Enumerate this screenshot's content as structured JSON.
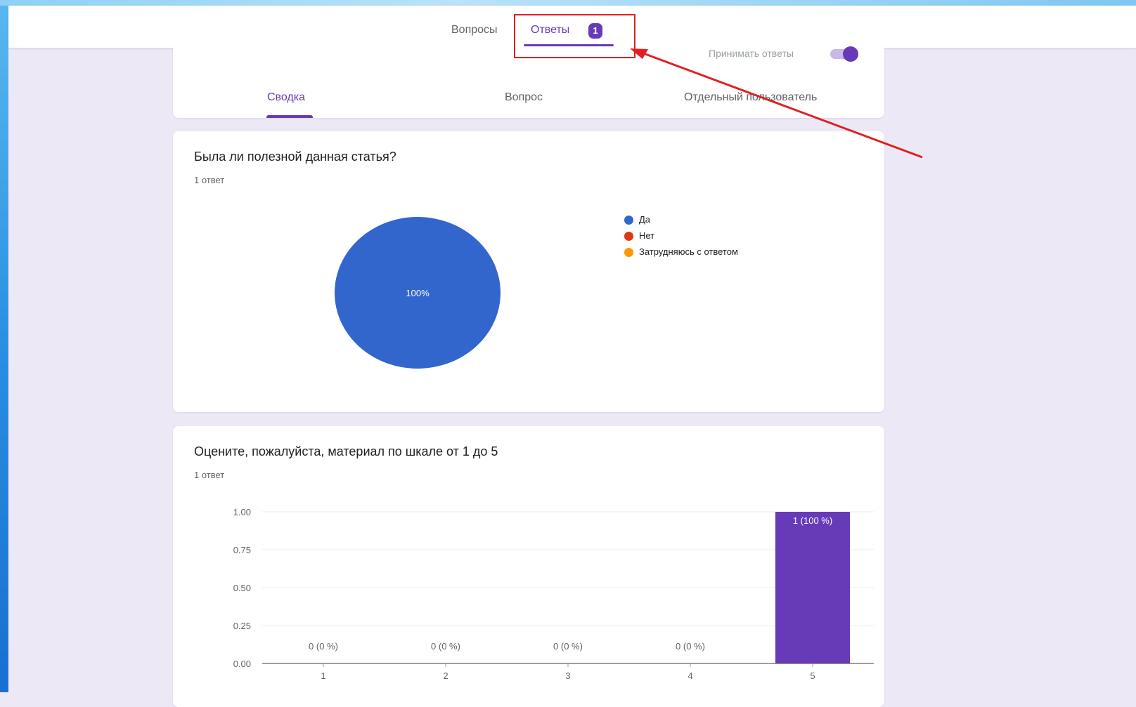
{
  "header": {
    "tabs": [
      {
        "label": "Вопросы"
      },
      {
        "label": "Ответы",
        "badge": "1"
      }
    ]
  },
  "summary_card": {
    "accept_label": "Принимать ответы",
    "accept_enabled": true,
    "subtabs": [
      {
        "label": "Сводка"
      },
      {
        "label": "Вопрос"
      },
      {
        "label": "Отдельный пользователь"
      }
    ]
  },
  "questions": [
    {
      "title": "Была ли полезной данная статья?",
      "count_text": "1 ответ"
    },
    {
      "title": "Оцените, пожалуйста, материал по шкале от 1 до 5",
      "count_text": "1 ответ"
    }
  ],
  "chart_data": [
    {
      "type": "pie",
      "categories": [
        "Да",
        "Нет",
        "Затрудняюсь с ответом"
      ],
      "values": [
        1,
        0,
        0
      ],
      "colors": [
        "#3366cc",
        "#dc3912",
        "#ff9900"
      ],
      "slice_labels": [
        "100%",
        "",
        ""
      ],
      "legend_position": "right"
    },
    {
      "type": "bar",
      "categories": [
        "1",
        "2",
        "3",
        "4",
        "5"
      ],
      "values": [
        0,
        0,
        0,
        0,
        1
      ],
      "data_labels": [
        "0 (0 %)",
        "0 (0 %)",
        "0 (0 %)",
        "0 (0 %)",
        "1 (100 %)"
      ],
      "yticks": [
        "0.00",
        "0.25",
        "0.50",
        "0.75",
        "1.00"
      ],
      "ylim": [
        0,
        1
      ],
      "color": "#673ab7",
      "grid": true
    }
  ],
  "colors": {
    "accent": "#673ab7",
    "background": "#ece8f5",
    "annotation": "#e02020"
  }
}
